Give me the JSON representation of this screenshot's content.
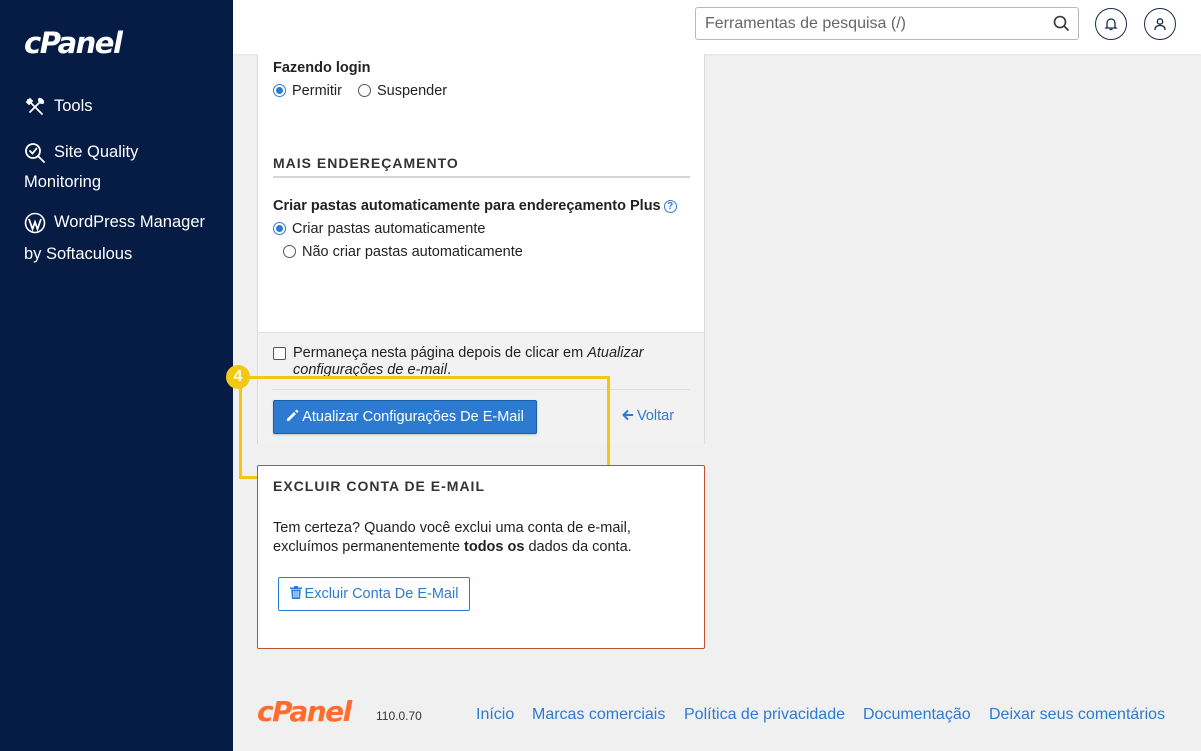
{
  "sidebar": {
    "logo": "cPanel",
    "items": [
      {
        "label": "Tools",
        "icon": "tools-icon"
      },
      {
        "label": "Site Quality",
        "label2": "Monitoring",
        "icon": "site-quality-icon"
      },
      {
        "label": "WordPress Manager",
        "label2": "by Softaculous",
        "icon": "wordpress-icon"
      }
    ]
  },
  "header": {
    "search_placeholder": "Ferramentas de pesquisa (/)"
  },
  "form": {
    "login_label": "Fazendo login",
    "login_options": [
      "Permitir",
      "Suspender"
    ],
    "login_selected": "Permitir",
    "section_title": "MAIS ENDEREÇAMENTO",
    "plus_label": "Criar pastas automaticamente para endereçamento Plus",
    "plus_options": [
      "Criar pastas automaticamente",
      "Não criar pastas automaticamente"
    ],
    "plus_selected": "Criar pastas automaticamente",
    "stay_prefix": "Permaneça nesta página depois de clicar em ",
    "stay_italic": "Atualizar configurações de e-mail",
    "stay_suffix": ".",
    "update_button": "Atualizar Configurações De E-Mail",
    "back_link": "Voltar"
  },
  "step_badge": "4",
  "delete": {
    "title": "EXCLUIR CONTA DE E-MAIL",
    "text_prefix": "Tem certeza? Quando você exclui uma conta de e-mail, excluímos permanentemente ",
    "text_bold": "todos os",
    "text_suffix": " dados da conta.",
    "button": "Excluir Conta De E-Mail"
  },
  "footer": {
    "logo": "cPanel",
    "version": "110.0.70",
    "links": [
      "Início",
      "Marcas comerciais",
      "Política de privacidade",
      "Documentação",
      "Deixar seus comentários"
    ]
  },
  "colors": {
    "sidebar_bg": "#071c45",
    "accent": "#2d7bd1",
    "highlight": "#f2c811",
    "danger_border": "#c0502e",
    "brand_orange": "#ff6c2c"
  }
}
